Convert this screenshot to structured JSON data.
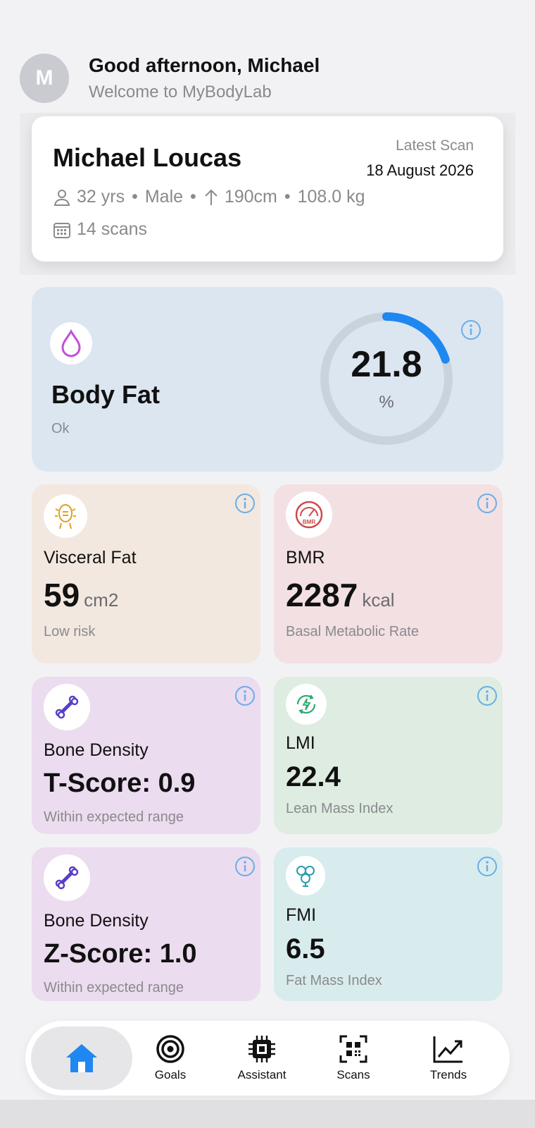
{
  "header": {
    "avatar_initial": "M",
    "greeting": "Good afternoon, Michael",
    "subtitle": "Welcome to MyBodyLab"
  },
  "profile": {
    "name": "Michael Loucas",
    "latest_scan_label": "Latest Scan",
    "latest_scan_date": "18 August 2026",
    "age": "32 yrs",
    "sex": "Male",
    "height": "190cm",
    "weight": "108.0 kg",
    "scans": "14 scans",
    "separator": "•"
  },
  "body_fat": {
    "title": "Body Fat",
    "status": "Ok",
    "value": "21.8",
    "unit": "%",
    "gauge_fraction": 0.2,
    "accent": "#1e88f0",
    "icon": "drop-icon"
  },
  "cards": {
    "visceral": {
      "label": "Visceral Fat",
      "value": "59",
      "unit": "cm2",
      "note": "Low risk",
      "bg": "#f2e8df",
      "icon": "torso-icon"
    },
    "bmr": {
      "label": "BMR",
      "value": "2287",
      "unit": "kcal",
      "note": "Basal Metabolic Rate",
      "bg": "#f3e0e3",
      "icon": "gauge-icon"
    },
    "bone_t": {
      "label": "Bone Density",
      "value": "T-Score: 0.9",
      "note": "Within expected range",
      "bg": "#ecdcef",
      "icon": "bone-icon"
    },
    "lmi": {
      "label": "LMI",
      "value": "22.4",
      "note": "Lean Mass Index",
      "bg": "#deece2",
      "icon": "energy-icon"
    },
    "bone_z": {
      "label": "Bone Density",
      "value": "Z-Score: 1.0",
      "note": "Within expected range",
      "bg": "#ecdcef",
      "icon": "bone-icon"
    },
    "fmi": {
      "label": "FMI",
      "value": "6.5",
      "note": "Fat Mass Index",
      "bg": "#d8ecee",
      "icon": "fat-cells-icon"
    }
  },
  "tabs": [
    {
      "label": "",
      "icon": "home-icon",
      "active": true
    },
    {
      "label": "Goals",
      "icon": "target-icon"
    },
    {
      "label": "Assistant",
      "icon": "chip-icon"
    },
    {
      "label": "Scans",
      "icon": "qr-icon"
    },
    {
      "label": "Trends",
      "icon": "trend-icon"
    }
  ],
  "colors": {
    "info": "#6aaee8",
    "tab_active": "#1e88f0"
  }
}
